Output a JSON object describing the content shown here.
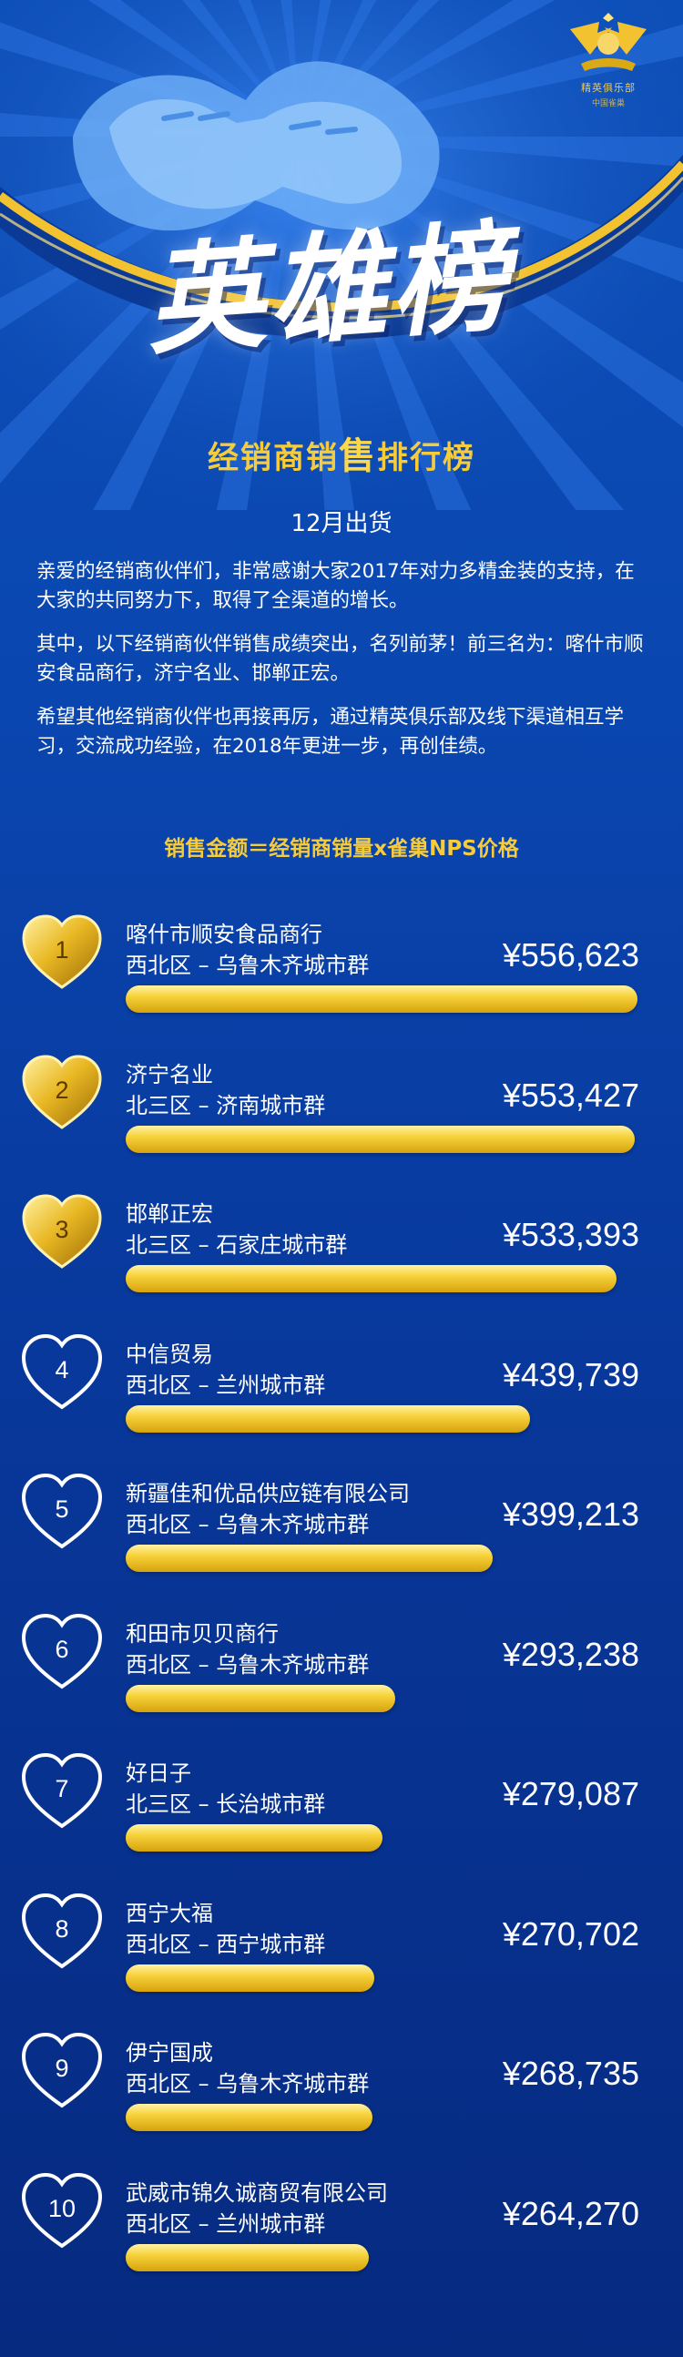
{
  "logo": {
    "name": "精英俱乐部",
    "sub": "中国雀巢"
  },
  "hero": {
    "title": "英雄榜",
    "subtitle_part1": "经销商销",
    "subtitle_part2": "售",
    "subtitle_part3": "排行榜"
  },
  "period": "12月出货",
  "intro": {
    "p1": "亲爱的经销商伙伴们，非常感谢大家2017年对力多精金装的支持，在大家的共同努力下，取得了全渠道的增长。",
    "p2": "其中，以下经销商伙伴销售成绩突出，名列前茅！前三名为：喀什市顺安食品商行，济宁名业、邯郸正宏。",
    "p3": "希望其他经销商伙伴也再接再厉，通过精英俱乐部及线下渠道相互学习，交流成功经验，在2018年更进一步，再创佳绩。"
  },
  "formula": "销售金额＝经销商销量x雀巢NPS价格",
  "colors": {
    "gold": "#f7cc3a",
    "background": "#0a46b0",
    "heart_outline": "#ffffff"
  },
  "ranking": [
    {
      "rank": "1",
      "name": "喀什市顺安食品商行",
      "region": "西北区 – 乌鲁木齐城市群",
      "amount": "¥556,623",
      "value": 556623,
      "medal": "gold"
    },
    {
      "rank": "2",
      "name": "济宁名业",
      "region": "北三区 – 济南城市群",
      "amount": "¥553,427",
      "value": 553427,
      "medal": "gold"
    },
    {
      "rank": "3",
      "name": "邯郸正宏",
      "region": "北三区 – 石家庄城市群",
      "amount": "¥533,393",
      "value": 533393,
      "medal": "gold"
    },
    {
      "rank": "4",
      "name": "中信贸易",
      "region": "西北区 – 兰州城市群",
      "amount": "¥439,739",
      "value": 439739,
      "medal": "outline"
    },
    {
      "rank": "5",
      "name": "新疆佳和优品供应链有限公司",
      "region": "西北区 – 乌鲁木齐城市群",
      "amount": "¥399,213",
      "value": 399213,
      "medal": "outline"
    },
    {
      "rank": "6",
      "name": "和田市贝贝商行",
      "region": "西北区 – 乌鲁木齐城市群",
      "amount": "¥293,238",
      "value": 293238,
      "medal": "outline"
    },
    {
      "rank": "7",
      "name": "好日子",
      "region": "北三区 – 长治城市群",
      "amount": "¥279,087",
      "value": 279087,
      "medal": "outline"
    },
    {
      "rank": "8",
      "name": "西宁大福",
      "region": "西北区 – 西宁城市群",
      "amount": "¥270,702",
      "value": 270702,
      "medal": "outline"
    },
    {
      "rank": "9",
      "name": "伊宁国成",
      "region": "西北区 – 乌鲁木齐城市群",
      "amount": "¥268,735",
      "value": 268735,
      "medal": "outline"
    },
    {
      "rank": "10",
      "name": "武威市锦久诚商贸有限公司",
      "region": "西北区 – 兰州城市群",
      "amount": "¥264,270",
      "value": 264270,
      "medal": "outline"
    }
  ]
}
